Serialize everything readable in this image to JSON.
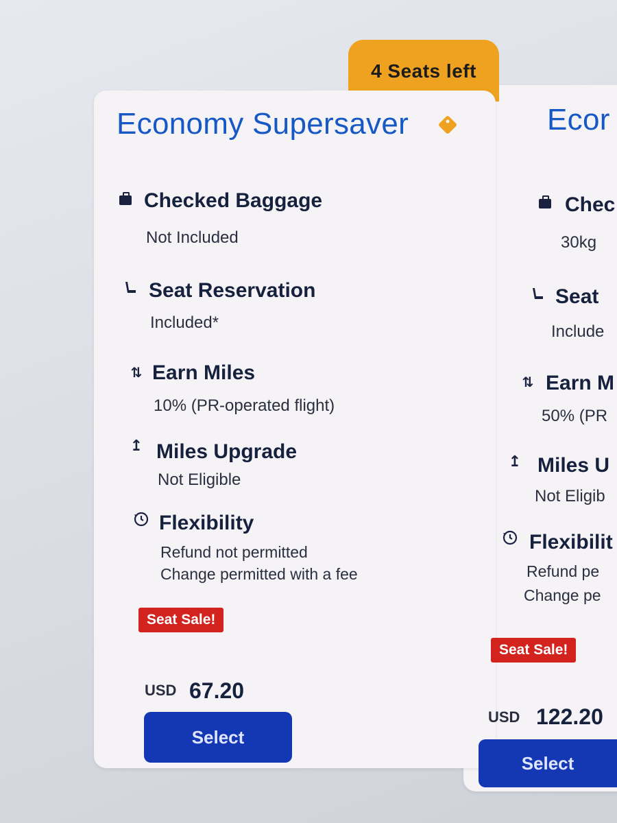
{
  "badge": {
    "seats_left": "4 Seats left"
  },
  "cards": [
    {
      "title": "Economy Supersaver",
      "features": [
        {
          "icon": "luggage-icon",
          "title": "Checked Baggage",
          "value": "Not Included"
        },
        {
          "icon": "seat-icon",
          "title": "Seat Reservation",
          "value": "Included*"
        },
        {
          "icon": "miles-icon",
          "title": "Earn Miles",
          "value": "10% (PR-operated flight)"
        },
        {
          "icon": "upgrade-arrow-icon",
          "title": "Miles Upgrade",
          "value": "Not Eligible"
        },
        {
          "icon": "history-clock-icon",
          "title": "Flexibility",
          "value": "Refund not permitted",
          "value2": "Change permitted with a fee"
        }
      ],
      "sale_label": "Seat Sale!",
      "currency": "USD",
      "price": "67.20",
      "select_label": "Select"
    },
    {
      "title": "Ecor",
      "features": [
        {
          "icon": "luggage-icon",
          "title": "Chec",
          "value": "30kg"
        },
        {
          "icon": "seat-icon",
          "title": "Seat",
          "value": "Include"
        },
        {
          "icon": "miles-icon",
          "title": "Earn M",
          "value": "50% (PR"
        },
        {
          "icon": "upgrade-arrow-icon",
          "title": "Miles U",
          "value": "Not Eligib"
        },
        {
          "icon": "history-clock-icon",
          "title": "Flexibilit",
          "value": "Refund pe",
          "value2": "Change pe"
        }
      ],
      "sale_label": "Seat Sale!",
      "currency": "USD",
      "price": "122.20",
      "select_label": "Select"
    }
  ],
  "colors": {
    "title_blue": "#1658c4",
    "badge_orange": "#eea21f",
    "sale_red": "#d2231f",
    "button_blue": "#1438b4"
  }
}
